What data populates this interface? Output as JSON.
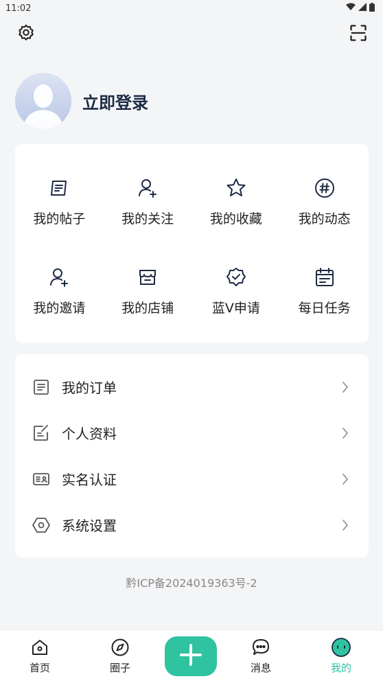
{
  "status_bar": {
    "time": "11:02",
    "icons": [
      "wifi-icon",
      "signal-icon",
      "battery-icon"
    ]
  },
  "header": {
    "left_icon": "gear-icon",
    "right_icon": "scan-icon"
  },
  "profile": {
    "login_label": "立即登录",
    "avatar_icon": "avatar-placeholder"
  },
  "quick_grid": {
    "items": [
      {
        "label": "我的帖子",
        "icon": "post-icon"
      },
      {
        "label": "我的关注",
        "icon": "follow-user-icon"
      },
      {
        "label": "我的收藏",
        "icon": "star-icon"
      },
      {
        "label": "我的动态",
        "icon": "hashtag-icon"
      },
      {
        "label": "我的邀请",
        "icon": "invite-user-icon"
      },
      {
        "label": "我的店铺",
        "icon": "store-icon"
      },
      {
        "label": "蓝V申请",
        "icon": "verified-badge-icon"
      },
      {
        "label": "每日任务",
        "icon": "calendar-icon"
      }
    ]
  },
  "menu_list": {
    "items": [
      {
        "label": "我的订单",
        "icon": "order-list-icon"
      },
      {
        "label": "个人资料",
        "icon": "edit-profile-icon"
      },
      {
        "label": "实名认证",
        "icon": "id-card-icon"
      },
      {
        "label": "系统设置",
        "icon": "hexagon-settings-icon"
      }
    ]
  },
  "footer": {
    "icp": "黔ICP备2024019363号-2"
  },
  "tab_bar": {
    "tabs": [
      {
        "label": "首页",
        "icon": "home-icon"
      },
      {
        "label": "圈子",
        "icon": "compass-icon"
      },
      {
        "label": "消息",
        "icon": "chat-icon"
      },
      {
        "label": "我的",
        "icon": "me-face-icon"
      }
    ],
    "add_icon": "plus-icon",
    "active_color": "#2fc3a0"
  },
  "colors": {
    "accent": "#2fc3a0",
    "background": "#f4f5f7",
    "title": "#1d2a44"
  }
}
